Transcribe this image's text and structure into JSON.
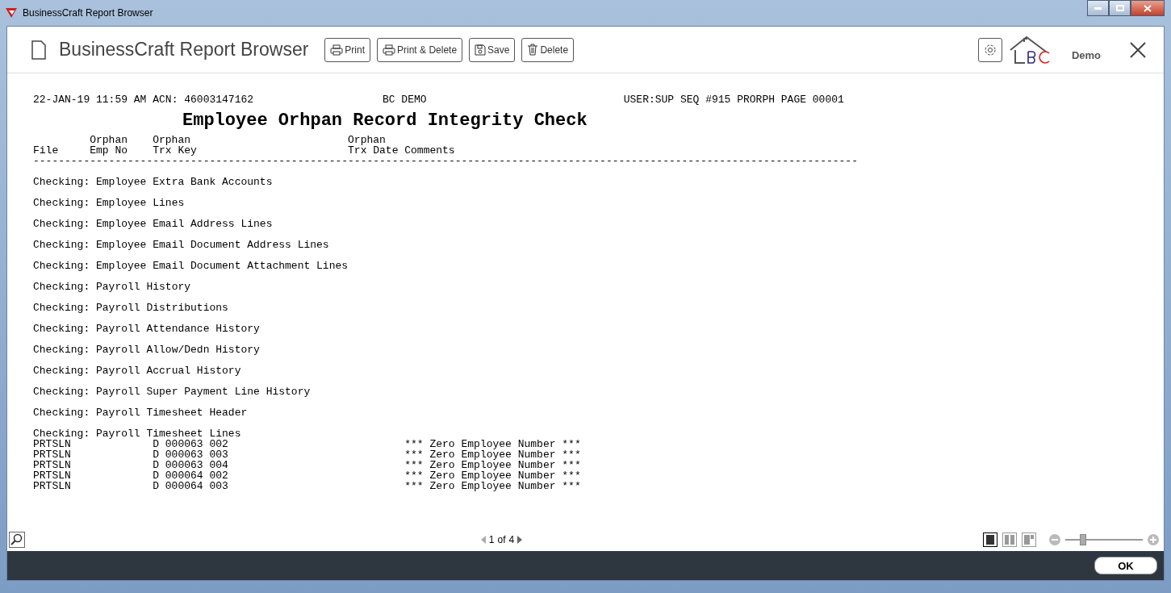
{
  "window": {
    "title": "BusinessCraft Report Browser"
  },
  "header": {
    "title": "BusinessCraft Report Browser",
    "buttons": [
      "Print",
      "Print & Delete",
      "Save",
      "Delete"
    ],
    "brand": "Demo"
  },
  "report": {
    "meta": [
      "22-JAN-19 11:59 AM ACN: 46003147162",
      "BC DEMO",
      "USER:SUP SEQ #915 PRORPH PAGE 00001"
    ],
    "title": "Employee Orhpan Record Integrity Check",
    "columns": [
      {
        "bottom": "File"
      },
      {
        "top": "Orphan",
        "bottom": "Emp No"
      },
      {
        "top": "Orphan",
        "bottom": "Trx Key"
      },
      {
        "top": "Orphan",
        "bottom": "Trx Date Comments"
      }
    ],
    "rule": "-----------------------------------------------------------------------------------------------------------------------------------",
    "sections": [
      {
        "label": "Checking: Employee Extra Bank Accounts"
      },
      {
        "label": "Checking: Employee Lines"
      },
      {
        "label": "Checking: Employee Email Address Lines"
      },
      {
        "label": "Checking: Employee Email Document Address Lines"
      },
      {
        "label": "Checking: Employee Email Document Attachment Lines"
      },
      {
        "label": "Checking: Payroll History"
      },
      {
        "label": "Checking: Payroll Distributions"
      },
      {
        "label": "Checking: Payroll Attendance History"
      },
      {
        "label": "Checking: Payroll Allow/Dedn History"
      },
      {
        "label": "Checking: Payroll Accrual History"
      },
      {
        "label": "Checking: Payroll Super Payment Line History"
      },
      {
        "label": "Checking: Payroll Timesheet Header"
      },
      {
        "label": "Checking: Payroll Timesheet Lines",
        "rows": [
          {
            "file": "PRTSLN",
            "key": "D 000063 002",
            "comment": "*** Zero Employee Number ***"
          },
          {
            "file": "PRTSLN",
            "key": "D 000063 003",
            "comment": "*** Zero Employee Number ***"
          },
          {
            "file": "PRTSLN",
            "key": "D 000063 004",
            "comment": "*** Zero Employee Number ***"
          },
          {
            "file": "PRTSLN",
            "key": "D 000064 002",
            "comment": "*** Zero Employee Number ***"
          },
          {
            "file": "PRTSLN",
            "key": "D 000064 003",
            "comment": "*** Zero Employee Number ***"
          }
        ]
      }
    ]
  },
  "pager": {
    "current": "1",
    "of": "of",
    "total": "4"
  },
  "views": [
    {
      "kind": "single",
      "selected": true
    },
    {
      "kind": "double",
      "selected": false
    },
    {
      "kind": "detail",
      "selected": false
    }
  ],
  "zoom": {
    "level": 0.2
  },
  "ok": "OK"
}
